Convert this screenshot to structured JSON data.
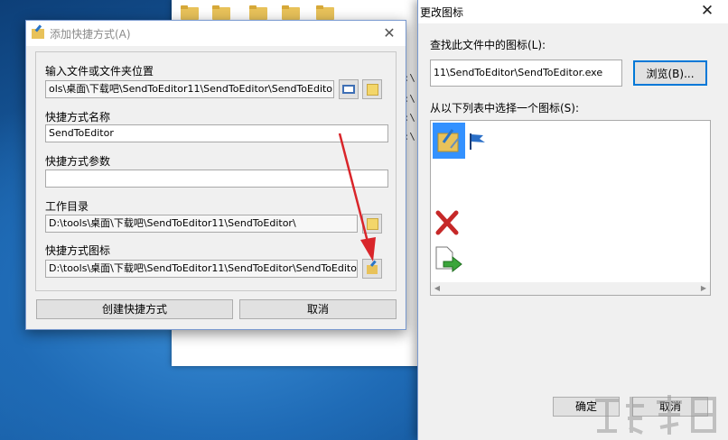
{
  "shortcut_dialog": {
    "title": "添加快捷方式(A)",
    "target_label": "输入文件或文件夹位置",
    "target_value": "ols\\桌面\\下载吧\\SendToEditor11\\SendToEditor\\SendToEditor.exe",
    "name_label": "快捷方式名称",
    "name_value": "SendToEditor",
    "args_label": "快捷方式参数",
    "args_value": "",
    "workdir_label": "工作目录",
    "workdir_value": "D:\\tools\\桌面\\下载吧\\SendToEditor11\\SendToEditor\\",
    "icon_label": "快捷方式图标",
    "icon_value": "D:\\tools\\桌面\\下载吧\\SendToEditor11\\SendToEditor\\SendToEditor.exe",
    "create_button": "创建快捷方式",
    "cancel_button": "取消"
  },
  "icon_dialog": {
    "title": "更改图标",
    "find_label": "查找此文件中的图标(L):",
    "path_value": "11\\SendToEditor\\SendToEditor.exe",
    "browse_button": "浏览(B)...",
    "list_label": "从以下列表中选择一个图标(S):",
    "ok_button": "确定",
    "cancel_button": "取消"
  },
  "explorer_fragment": {
    "rows": [
      "C:\\",
      "C:\\",
      "C:\\",
      "C:\\"
    ]
  },
  "colors": {
    "selection": "#3391ff",
    "arrow": "#d9252a",
    "accent_border": "#7a9ad0"
  }
}
